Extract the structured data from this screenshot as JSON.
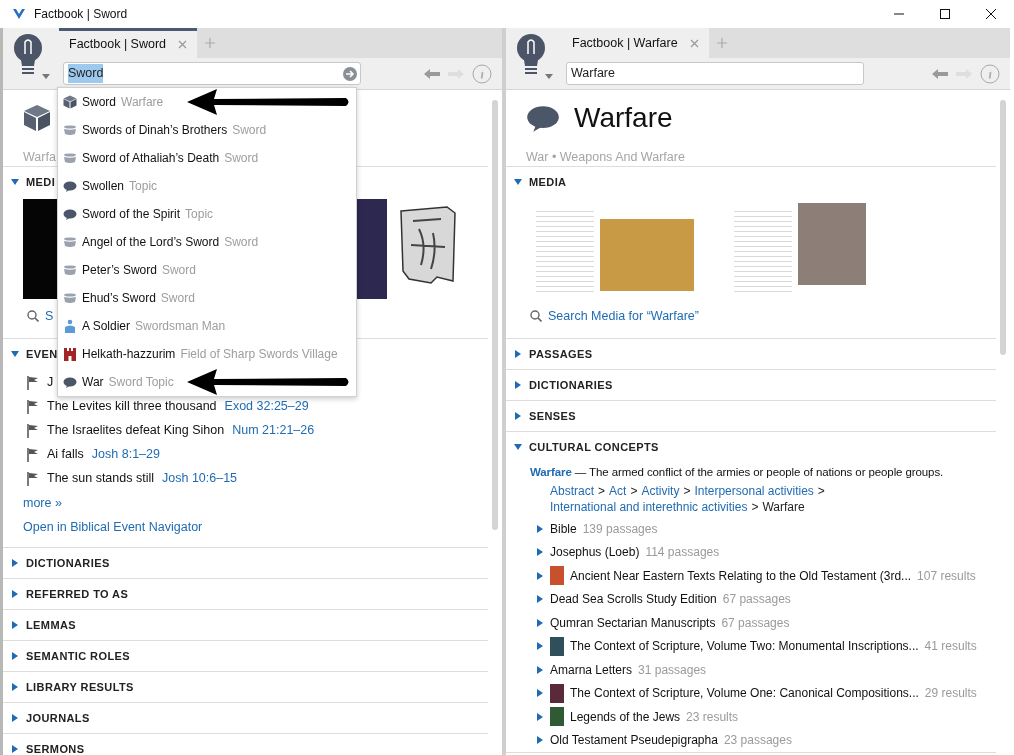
{
  "window": {
    "title": "Factbook | Sword"
  },
  "panes": [
    {
      "focused": true,
      "tabs": [
        {
          "label": "Factbook | Sword",
          "selected": true
        }
      ],
      "search": {
        "value": "Sword",
        "highlighted": true
      },
      "header": {
        "kind": "cube",
        "subtitle": "Warfa"
      },
      "sections": [
        {
          "kind": "media",
          "heading": "MEDI",
          "expanded": true,
          "images": [
            {
              "kind": "dark"
            },
            {
              "kind": "purple"
            },
            {
              "kind": "stone"
            }
          ],
          "search_link": "S"
        },
        {
          "kind": "events",
          "heading": "EVEN",
          "expanded": true,
          "items": [
            {
              "label": "J"
            },
            {
              "label": "The Levites kill three thousand",
              "ref": "Exod 32:25–29"
            },
            {
              "label": "The Israelites defeat King Sihon",
              "ref": "Num 21:21–26"
            },
            {
              "label": "Ai falls",
              "ref": "Josh 8:1–29"
            },
            {
              "label": "The sun stands still",
              "ref": "Josh 10:6–15"
            }
          ],
          "more": "more »",
          "open_link": "Open in Biblical Event Navigator"
        },
        {
          "kind": "plain",
          "heading": "DICTIONARIES",
          "expanded": false
        },
        {
          "kind": "plain",
          "heading": "REFERRED TO AS",
          "expanded": false
        },
        {
          "kind": "plain",
          "heading": "LEMMAS",
          "expanded": false
        },
        {
          "kind": "plain",
          "heading": "SEMANTIC ROLES",
          "expanded": false
        },
        {
          "kind": "plain",
          "heading": "LIBRARY RESULTS",
          "expanded": false
        },
        {
          "kind": "plain",
          "heading": "JOURNALS",
          "expanded": false
        },
        {
          "kind": "plain",
          "heading": "SERMONS",
          "expanded": false
        }
      ],
      "dropdown": {
        "items": [
          {
            "kind": "cube",
            "label": "Sword",
            "category": "Warfare",
            "marked": true
          },
          {
            "kind": "bowl",
            "label": "Swords of Dinah’s Brothers",
            "category": "Sword",
            "marked": false
          },
          {
            "kind": "bowl",
            "label": "Sword of Athaliah’s Death",
            "category": "Sword",
            "marked": false
          },
          {
            "kind": "speech",
            "label": "Swollen",
            "category": "Topic",
            "marked": false
          },
          {
            "kind": "speech",
            "label": "Sword of the Spirit",
            "category": "Topic",
            "marked": false
          },
          {
            "kind": "bowl",
            "label": "Angel of the Lord’s Sword",
            "category": "Sword",
            "marked": false
          },
          {
            "kind": "bowl",
            "label": "Peter’s Sword",
            "category": "Sword",
            "marked": false
          },
          {
            "kind": "bowl",
            "label": "Ehud’s Sword",
            "category": "Sword",
            "marked": false
          },
          {
            "kind": "person",
            "label": "A Soldier",
            "category": "Swordsman Man",
            "marked": false
          },
          {
            "kind": "castle",
            "label": "Helkath-hazzurim",
            "category": "Field of Sharp Swords Village",
            "marked": false
          },
          {
            "kind": "speech",
            "label": "War",
            "category": "Sword Topic",
            "marked": true
          }
        ]
      }
    },
    {
      "focused": false,
      "tabs": [
        {
          "label": "Factbook | Warfare",
          "selected": true
        }
      ],
      "search": {
        "value": "Warfare",
        "highlighted": false
      },
      "header": {
        "kind": "speech",
        "title": "Warfare",
        "subtitle": "War • Weapons And Warfare"
      },
      "sections": [
        {
          "kind": "media",
          "heading": "MEDIA",
          "expanded": true,
          "images": [
            {
              "kind": "artillery"
            },
            {
              "kind": "siege"
            }
          ],
          "search_link": "Search Media for “Warfare”"
        },
        {
          "kind": "plain",
          "heading": "PASSAGES",
          "expanded": false
        },
        {
          "kind": "plain",
          "heading": "DICTIONARIES",
          "expanded": false
        },
        {
          "kind": "plain",
          "heading": "SENSES",
          "expanded": false
        },
        {
          "kind": "concepts",
          "heading": "CULTURAL CONCEPTS",
          "expanded": true,
          "term": "Warfare",
          "definition": "— The armed conflict of the armies or people of nations or people groups.",
          "separator": ">",
          "path": [
            {
              "label": "Abstract",
              "link": true
            },
            {
              "label": "Act",
              "link": true
            },
            {
              "label": "Activity",
              "link": true
            },
            {
              "label": "Interpersonal activities",
              "link": true
            },
            {
              "label": "International and interethnic activities",
              "link": true
            },
            {
              "label": "Warfare",
              "link": false
            }
          ],
          "items": [
            {
              "label": "Bible",
              "count": "139 passages"
            },
            {
              "label": "Josephus (Loeb)",
              "count": "114 passages"
            },
            {
              "label": "Ancient Near Eastern Texts Relating to the Old Testament (3rd...",
              "count": "107 results",
              "color": "#c9502e"
            },
            {
              "label": "Dead Sea Scrolls Study Edition",
              "count": "67 passages"
            },
            {
              "label": "Qumran Sectarian Manuscripts",
              "count": "67 passages"
            },
            {
              "label": "The Context of Scripture, Volume Two: Monumental Inscriptions...",
              "count": "41 results",
              "color": "#2f4f5a"
            },
            {
              "label": "Amarna Letters",
              "count": "31 passages"
            },
            {
              "label": "The Context of Scripture, Volume One: Canonical Compositions...",
              "count": "29 results",
              "color": "#5a2a3a"
            },
            {
              "label": "Legends of the Jews",
              "count": "23 results",
              "color": "#2f5a34"
            },
            {
              "label": "Old Testament Pseudepigrapha",
              "count": "23 passages"
            }
          ]
        }
      ]
    }
  ]
}
